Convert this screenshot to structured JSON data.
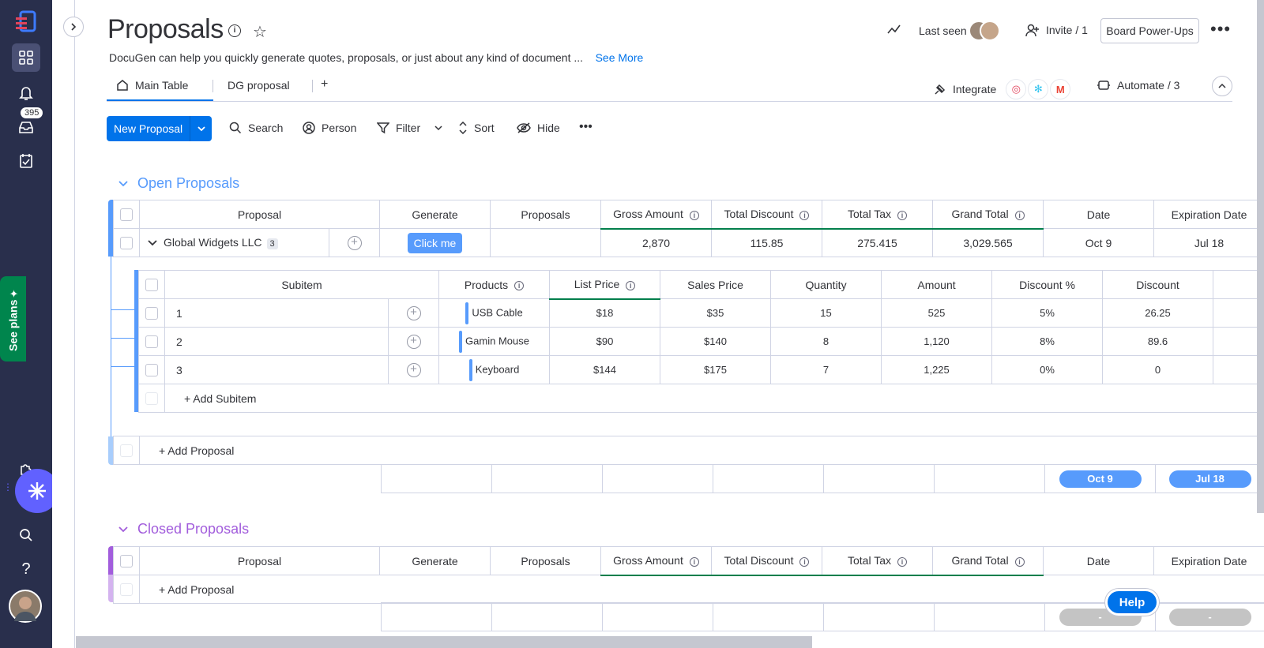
{
  "board": {
    "title": "Proposals",
    "description": "DocuGen can help you quickly generate quotes, proposals, or just about any kind of document ...",
    "see_more": "See More"
  },
  "header": {
    "last_seen": "Last seen",
    "invite": "Invite / 1",
    "power_ups": "Board Power-Ups"
  },
  "tabs": {
    "main_table": "Main Table",
    "dg_proposal": "DG proposal",
    "add": "+",
    "integrate": "Integrate",
    "automate": "Automate / 3"
  },
  "toolbar": {
    "new_proposal": "New Proposal",
    "search": "Search",
    "person": "Person",
    "filter": "Filter",
    "sort": "Sort",
    "hide": "Hide"
  },
  "leftbar": {
    "inbox_count": "395",
    "see_plans": "See plans"
  },
  "columns": {
    "proposal": "Proposal",
    "generate": "Generate",
    "proposals": "Proposals",
    "gross_amount": "Gross Amount",
    "total_discount": "Total Discount",
    "total_tax": "Total Tax",
    "grand_total": "Grand Total",
    "date": "Date",
    "expiration_date": "Expiration Date"
  },
  "open_group": {
    "title": "Open Proposals",
    "color": "#579bfc",
    "item": {
      "name": "Global Widgets LLC",
      "subitem_count": "3",
      "generate": "Click me",
      "gross_amount": "2,870",
      "total_discount": "115.85",
      "total_tax": "275.415",
      "grand_total": "3,029.565",
      "date": "Oct 9",
      "expiration_date": "Jul 18"
    },
    "add_item": "+ Add Proposal",
    "summary_date": "Oct 9",
    "summary_expiration": "Jul 18"
  },
  "subitems": {
    "columns": {
      "subitem": "Subitem",
      "products": "Products",
      "list_price": "List Price",
      "sales_price": "Sales Price",
      "quantity": "Quantity",
      "amount": "Amount",
      "discount_pct": "Discount %",
      "discount": "Discount"
    },
    "rows": [
      {
        "name": "1",
        "product": "USB Cable",
        "list_price": "$18",
        "sales_price": "$35",
        "quantity": "15",
        "amount": "525",
        "discount_pct": "5%",
        "discount": "26.25"
      },
      {
        "name": "2",
        "product": "Gamin Mouse",
        "list_price": "$90",
        "sales_price": "$140",
        "quantity": "8",
        "amount": "1,120",
        "discount_pct": "8%",
        "discount": "89.6"
      },
      {
        "name": "3",
        "product": "Keyboard",
        "list_price": "$144",
        "sales_price": "$175",
        "quantity": "7",
        "amount": "1,225",
        "discount_pct": "0%",
        "discount": "0"
      }
    ],
    "add_subitem": "+ Add Subitem"
  },
  "closed_group": {
    "title": "Closed Proposals",
    "color": "#a25ddc",
    "add_item": "+ Add Proposal",
    "summary_date": "-",
    "summary_expiration": "-"
  },
  "help": "Help"
}
